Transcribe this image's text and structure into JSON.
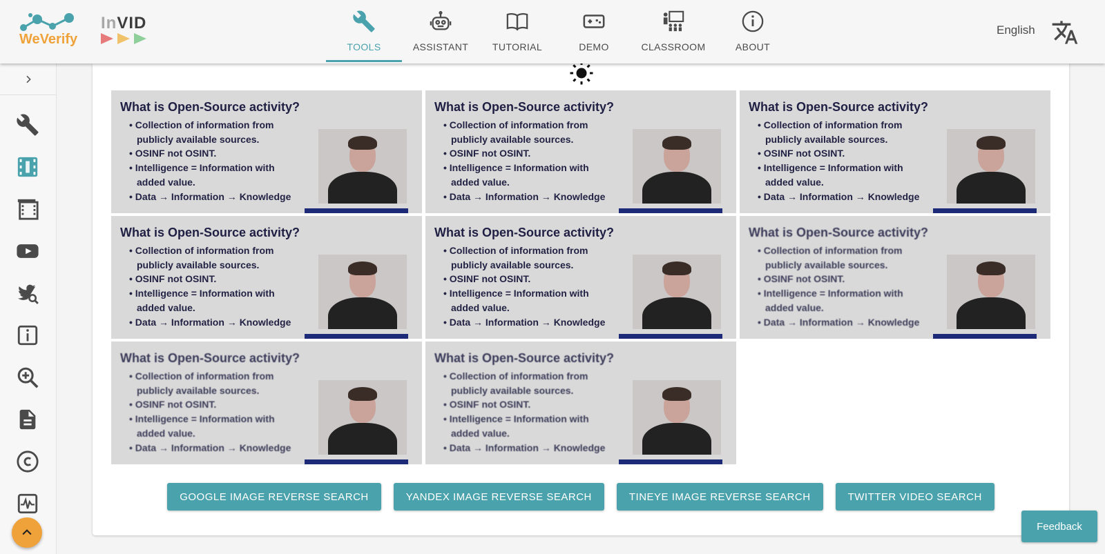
{
  "brand": {
    "weverify": "WeVerify",
    "invid_in": "In",
    "invid_vid": "VID",
    "colors": {
      "orange": "#f0a23a",
      "blue": "#4aa2ad"
    }
  },
  "nav": [
    {
      "label": "TOOLS",
      "icon": "wrench-icon",
      "active": true
    },
    {
      "label": "ASSISTANT",
      "icon": "robot-icon",
      "active": false
    },
    {
      "label": "TUTORIAL",
      "icon": "book-icon",
      "active": false
    },
    {
      "label": "DEMO",
      "icon": "gamepad-icon",
      "active": false
    },
    {
      "label": "CLASSROOM",
      "icon": "classroom-icon",
      "active": false
    },
    {
      "label": "ABOUT",
      "icon": "info-icon",
      "active": false
    }
  ],
  "language": {
    "label": "English",
    "icon": "translate-icon"
  },
  "sidebar": {
    "icons": [
      "wrench-icon",
      "video-analysis-icon",
      "film-icon",
      "youtube-icon",
      "twitter-search-icon",
      "info-box-icon",
      "magnifier-icon",
      "document-icon",
      "copyright-icon",
      "waveform-icon"
    ]
  },
  "slide": {
    "title": "What is Open-Source activity?",
    "bullets": [
      {
        "text": "Collection of information from",
        "cont": false
      },
      {
        "text": "publicly available sources.",
        "cont": true
      },
      {
        "text": "OSINF not OSINT.",
        "cont": false
      },
      {
        "text": "Intelligence = Information with",
        "cont": false
      },
      {
        "text": "added value.",
        "cont": true
      },
      {
        "text": "Data → Information → Knowledge",
        "cont": false
      }
    ]
  },
  "buttons": {
    "google": "GOOGLE IMAGE REVERSE SEARCH",
    "yandex": "YANDEX IMAGE REVERSE SEARCH",
    "tineye": "TINEYE IMAGE REVERSE SEARCH",
    "twitter": "TWITTER VIDEO SEARCH"
  },
  "feedback": "Feedback"
}
